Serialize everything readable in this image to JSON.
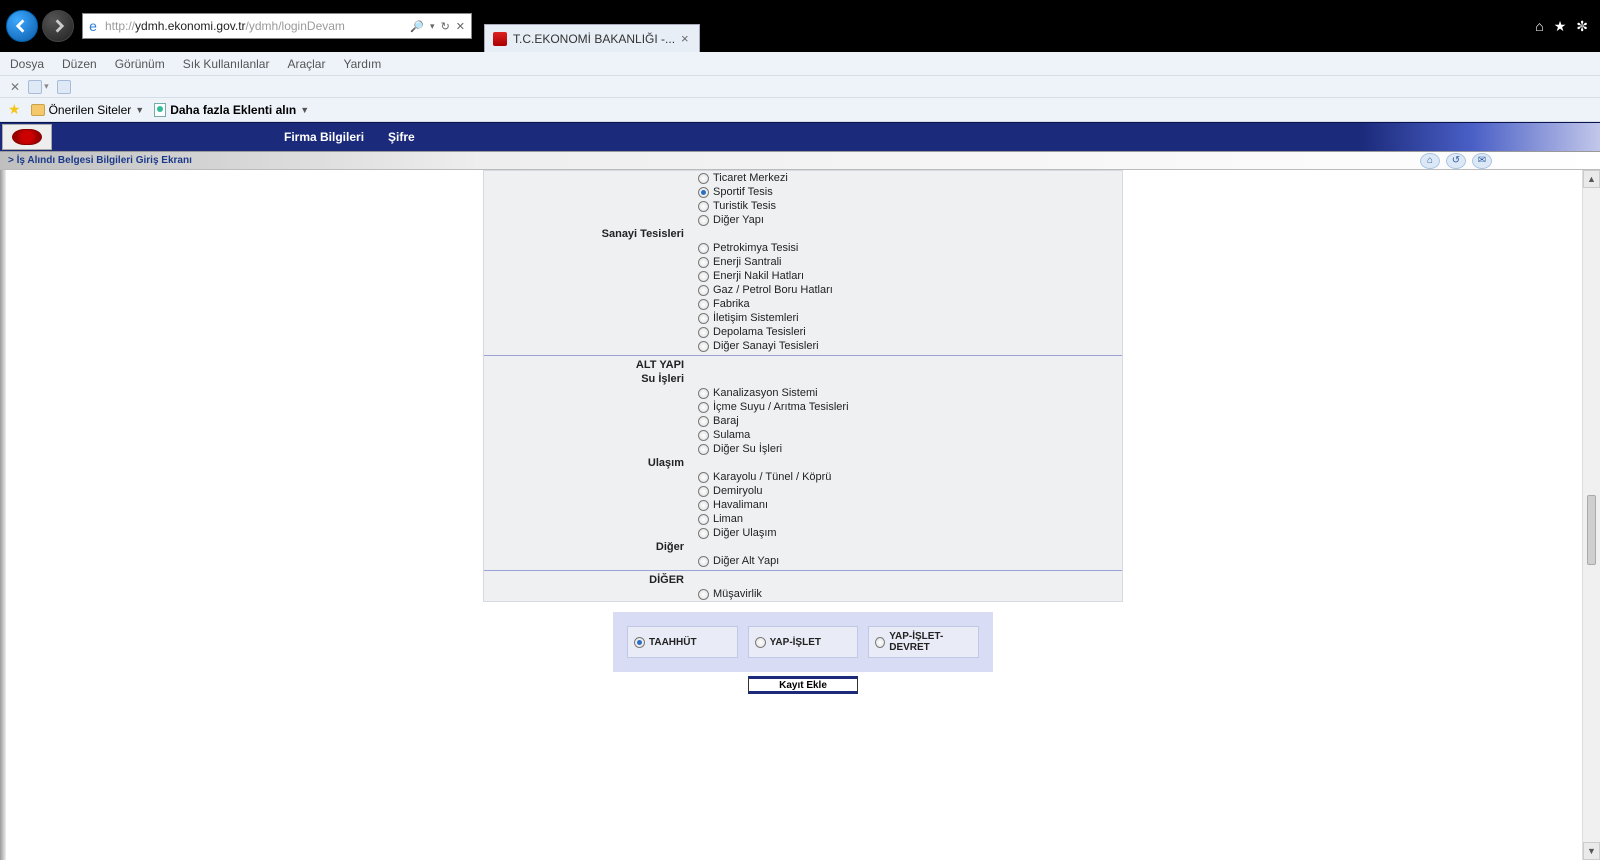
{
  "browser": {
    "url_prefix": "http://",
    "url_host": "ydmh.ekonomi.gov.tr",
    "url_path": "/ydmh/loginDevam",
    "search_hint": "🔍",
    "refresh_hint": "⟳",
    "stop_hint": "✕",
    "tab_title": "T.C.EKONOMİ BAKANLIĞI -...",
    "title_icons": {
      "home": "⌂",
      "star": "★",
      "gear": "✼"
    }
  },
  "menus": {
    "dosya": "Dosya",
    "duzen": "Düzen",
    "gorunum": "Görünüm",
    "sik": "Sık Kullanılanlar",
    "araclar": "Araçlar",
    "yardim": "Yardım"
  },
  "favbar": {
    "onerilen": "Önerilen Siteler",
    "daha": "Daha fazla Eklenti alın"
  },
  "app_menu": {
    "firma": "Firma Bilgileri",
    "sifre": "Şifre"
  },
  "crumb": "> İş Alındı Belgesi Bilgileri Giriş Ekranı",
  "groups": [
    {
      "sub": "",
      "options": [
        "Ticaret Merkezi",
        "Sportif Tesis",
        "Turistik Tesis",
        "Diğer Yapı"
      ],
      "selected": 1
    },
    {
      "sub": "Sanayi Tesisleri",
      "options": [
        "Petrokimya Tesisi",
        "Enerji Santrali",
        "Enerji Nakil Hatları",
        "Gaz / Petrol Boru Hatları",
        "Fabrika",
        "İletişim Sistemleri",
        "Depolama Tesisleri",
        "Diğer Sanayi Tesisleri"
      ],
      "selected": -1
    }
  ],
  "section_altyapi": "ALT YAPI",
  "groups2": [
    {
      "sub": "Su İşleri",
      "options": [
        "Kanalizasyon Sistemi",
        "İçme Suyu / Arıtma Tesisleri",
        "Baraj",
        "Sulama",
        "Diğer Su İşleri"
      ],
      "selected": -1
    },
    {
      "sub": "Ulaşım",
      "options": [
        "Karayolu / Tünel / Köprü",
        "Demiryolu",
        "Havalimanı",
        "Liman",
        "Diğer Ulaşım"
      ],
      "selected": -1
    },
    {
      "sub": "Diğer",
      "options": [
        "Diğer Alt Yapı"
      ],
      "selected": -1
    }
  ],
  "section_diger": "DİĞER",
  "groups3": [
    {
      "sub": "",
      "options": [
        "Müşavirlik"
      ],
      "selected": -1
    }
  ],
  "bottom": {
    "choices": [
      "TAAHHÜT",
      "YAP-İŞLET",
      "YAP-İŞLET-DEVRET"
    ],
    "selected": 0,
    "button": "Kayıt Ekle"
  }
}
